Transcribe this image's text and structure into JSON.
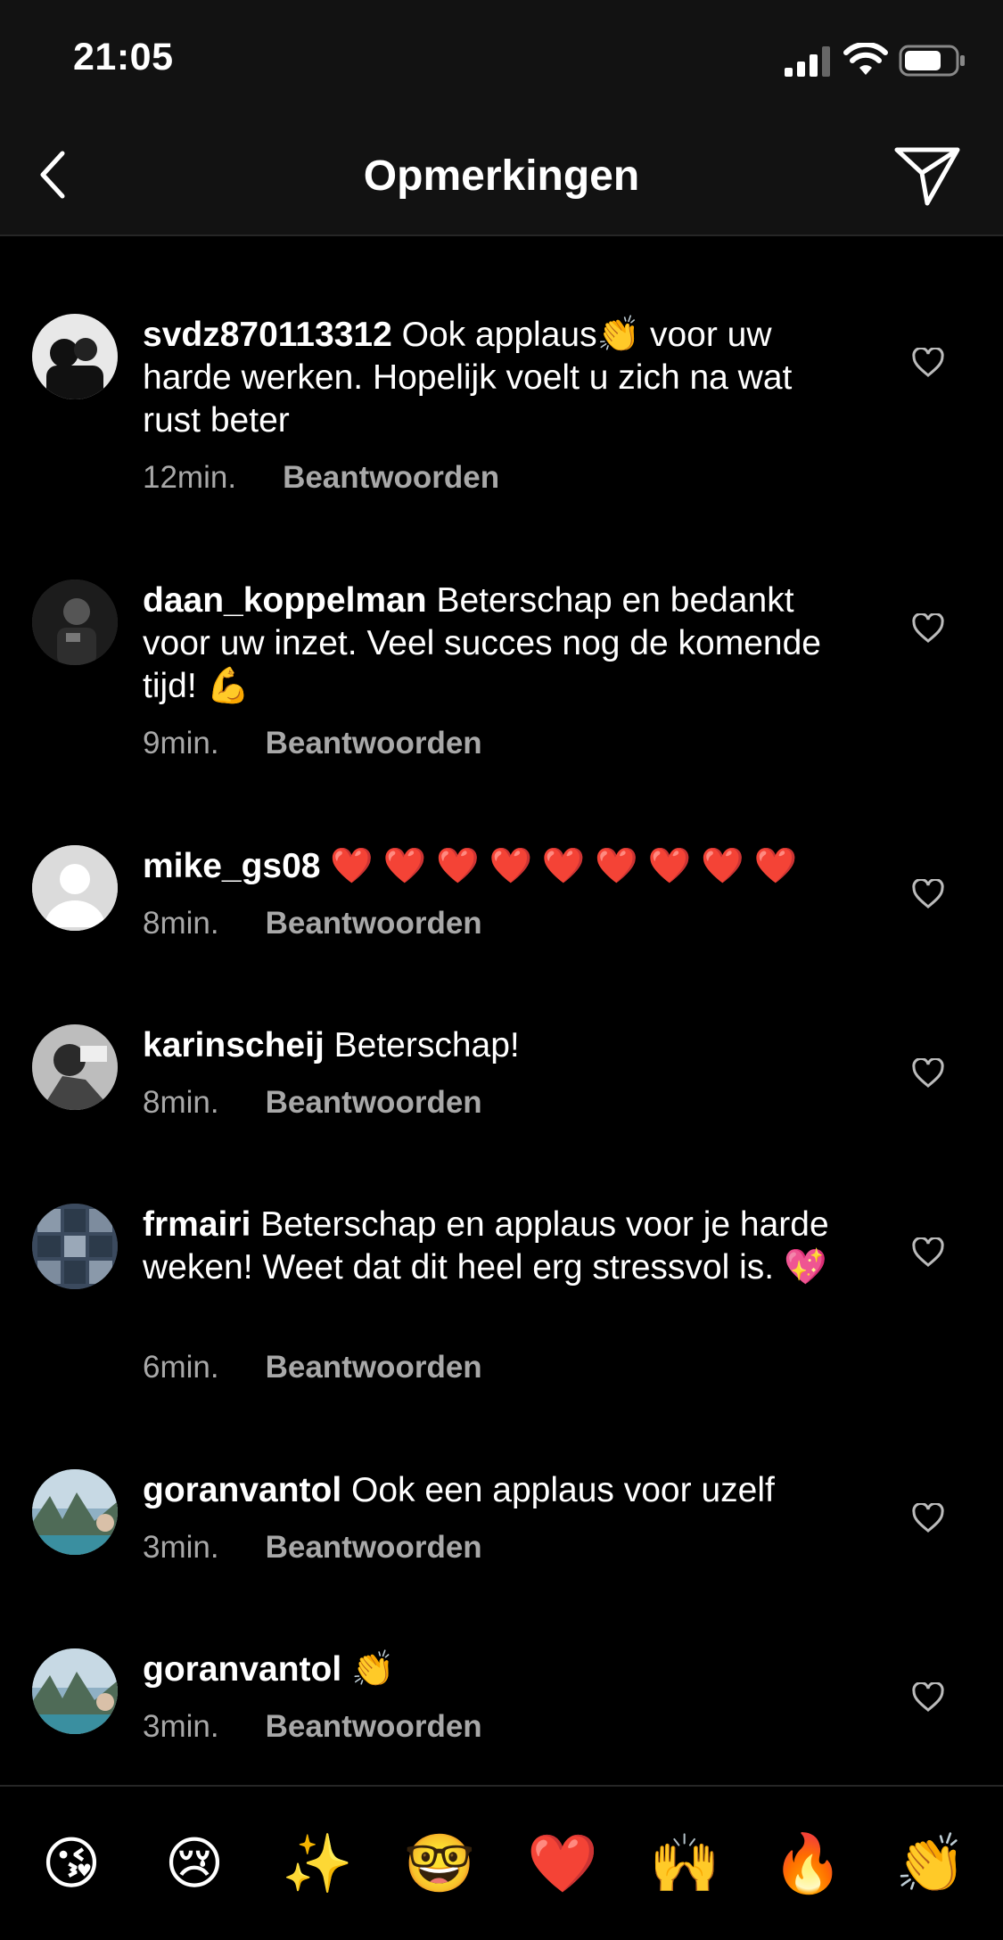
{
  "status": {
    "time": "21:05"
  },
  "nav": {
    "title": "Opmerkingen"
  },
  "comments": [
    {
      "username": "svdz870113312",
      "text": "Ook applaus👏 voor uw harde werken. Hopelijk voelt u zich na wat rust beter",
      "time": "12min.",
      "reply": "Beantwoorden"
    },
    {
      "username": "daan_koppelman",
      "text": "Beterschap en bedankt voor uw inzet. Veel succes nog de komende tijd! 💪",
      "time": "9min.",
      "reply": "Beantwoorden"
    },
    {
      "username": "mike_gs08",
      "text": "❤️ ❤️ ❤️ ❤️ ❤️ ❤️ ❤️ ❤️ ❤️",
      "time": "8min.",
      "reply": "Beantwoorden"
    },
    {
      "username": "karinscheij",
      "text": "Beterschap!",
      "time": "8min.",
      "reply": "Beantwoorden"
    },
    {
      "username": "frmairi",
      "text": "Beterschap en applaus voor je harde weken! Weet dat dit heel erg stressvol is. 💖",
      "time": "6min.",
      "reply": "Beantwoorden"
    },
    {
      "username": "goranvantol",
      "text": "Ook een applaus voor uzelf",
      "time": "3min.",
      "reply": "Beantwoorden"
    },
    {
      "username": "goranvantol",
      "text": "👏",
      "time": "3min.",
      "reply": "Beantwoorden"
    }
  ],
  "emoji_bar": [
    "😘",
    "😢",
    "✨",
    "🤓",
    "❤️",
    "🙌",
    "🔥",
    "👏"
  ]
}
